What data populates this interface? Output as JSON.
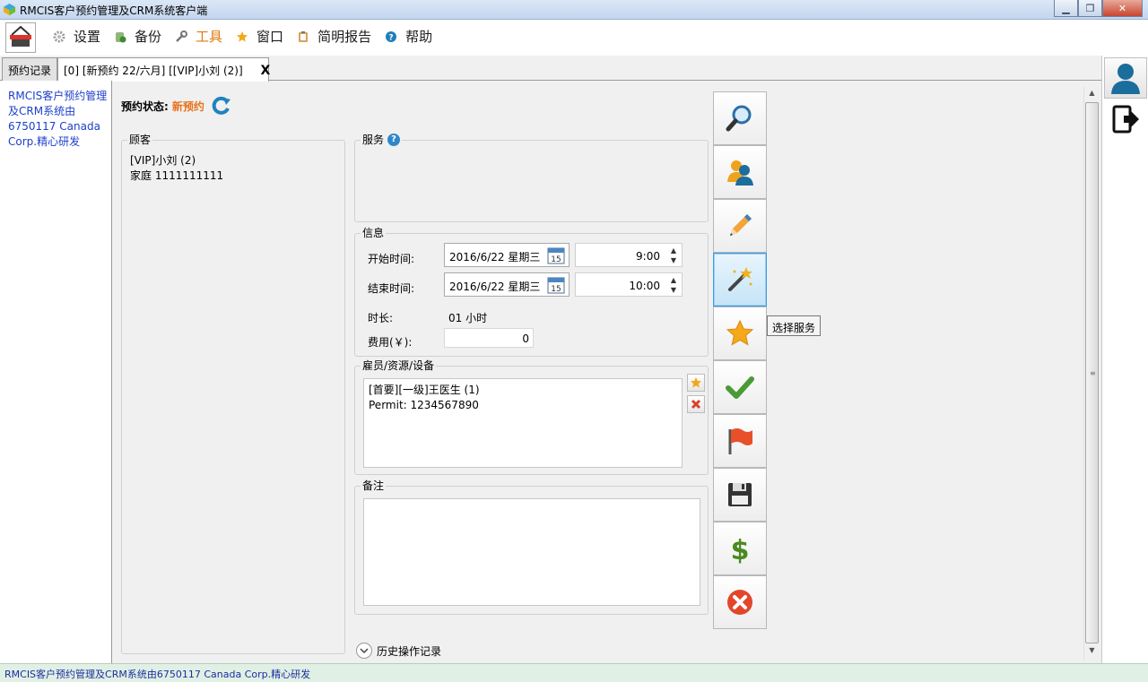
{
  "window": {
    "title": "RMCIS客户预约管理及CRM系统客户端"
  },
  "menu": {
    "items": [
      {
        "label": "设置",
        "icon": "gear-icon"
      },
      {
        "label": "备份",
        "icon": "backup-icon"
      },
      {
        "label": "工具",
        "icon": "wrench-icon"
      },
      {
        "label": "窗口",
        "icon": "star-icon"
      },
      {
        "label": "简明报告",
        "icon": "clipboard-icon"
      },
      {
        "label": "帮助",
        "icon": "help-icon"
      }
    ]
  },
  "tabs": {
    "records": "预约记录",
    "current": "[0] [新预约 22/六月] [[VIP]小刘 (2)]",
    "close": "X"
  },
  "sidebar": {
    "about_lines": [
      "RMCIS客户预约管理",
      "及CRM系统由",
      "6750117 Canada",
      "Corp.精心研发"
    ]
  },
  "appointment": {
    "status_label": "预约状态:",
    "status_value": "新预约",
    "customer": {
      "legend": "顾客",
      "name": "[VIP]小刘 (2)",
      "phone": "家庭 1111111111"
    },
    "service": {
      "legend": "服务"
    },
    "info": {
      "legend": "信息",
      "start_label": "开始时间:",
      "start_date": "2016/6/22 星期三",
      "start_time": "9:00",
      "end_label": "结束时间:",
      "end_date": "2016/6/22 星期三",
      "end_time": "10:00",
      "duration_label": "时长:",
      "duration_value": "01 小时",
      "fee_label": "费用(￥):",
      "fee_value": "0",
      "calendar_day": "15"
    },
    "staff": {
      "legend": "雇员/资源/设备",
      "line1": "[首要][一级]王医生 (1)",
      "line2": "Permit: 1234567890"
    },
    "notes": {
      "legend": "备注",
      "value": ""
    },
    "history_label": "历史操作记录"
  },
  "toolbar": {
    "buttons": [
      "search-icon",
      "customer-icon",
      "pencil-icon",
      "magic-wand-icon",
      "star-icon",
      "checkmark-icon",
      "flag-icon",
      "save-icon",
      "dollar-icon",
      "cancel-icon"
    ],
    "tooltip": "选择服务"
  },
  "statusbar": {
    "text": "RMCIS客户预约管理及CRM系统由6750117 Canada Corp.精心研发"
  },
  "colors": {
    "status_accent": "#e8711b",
    "link_blue": "#1c3fc9",
    "statusbar_bg": "#e1f0e5"
  }
}
